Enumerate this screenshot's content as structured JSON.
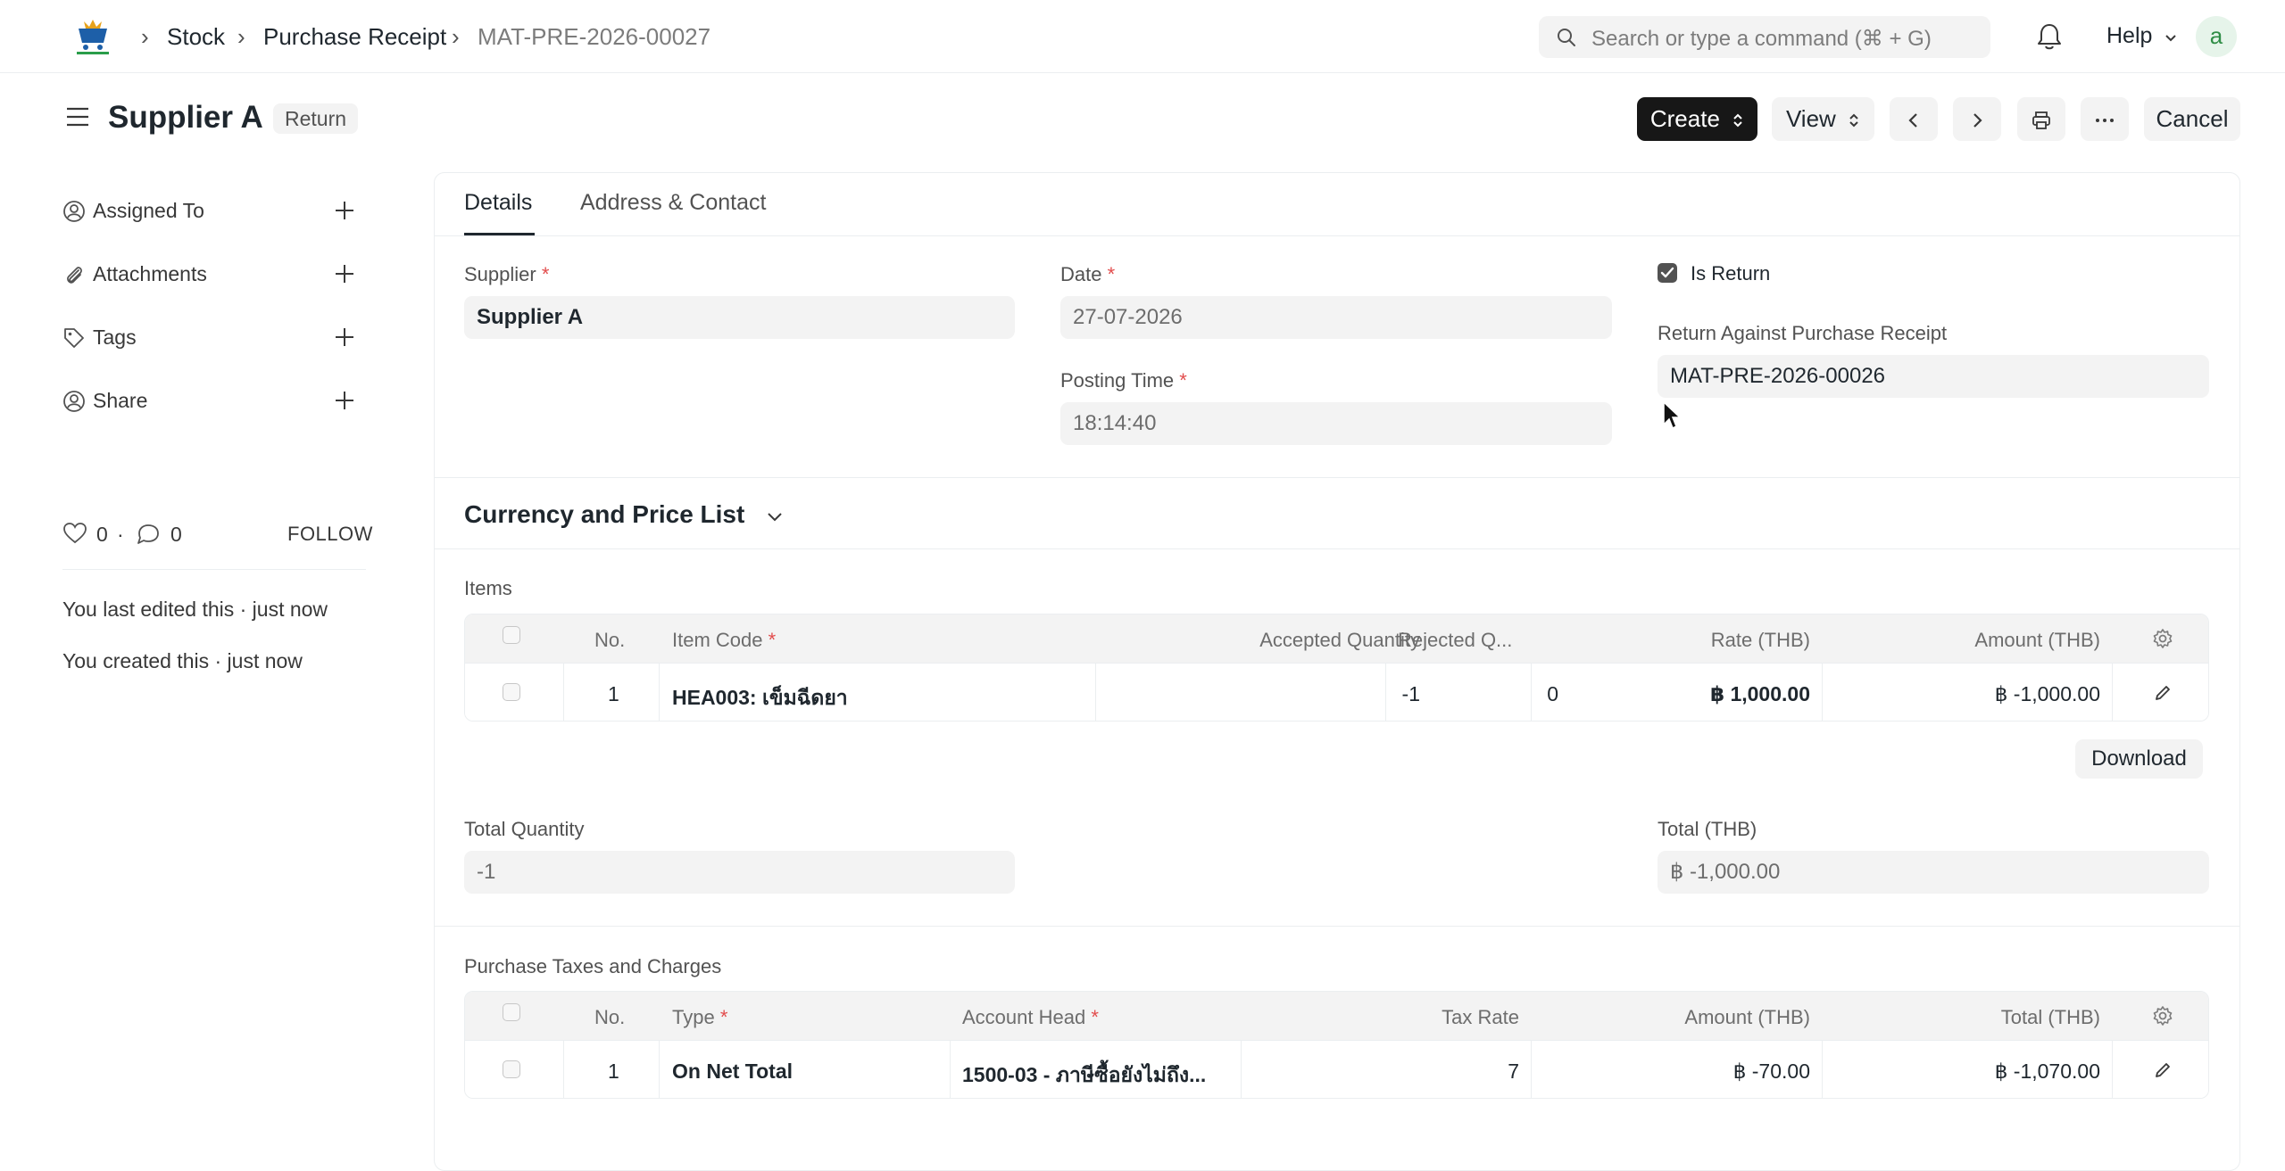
{
  "navbar": {
    "breadcrumbs": [
      "Stock",
      "Purchase Receipt",
      "MAT-PRE-2026-00027"
    ],
    "search_placeholder": "Search or type a command (⌘ + G)",
    "help_label": "Help",
    "avatar_letter": "a"
  },
  "page": {
    "title": "Supplier A",
    "status": "Return",
    "buttons": {
      "create": "Create",
      "view": "View",
      "cancel": "Cancel"
    }
  },
  "sidebar": {
    "items": [
      {
        "label": "Assigned To",
        "icon": "assign-user-icon"
      },
      {
        "label": "Attachments",
        "icon": "paperclip-icon"
      },
      {
        "label": "Tags",
        "icon": "tag-icon"
      },
      {
        "label": "Share",
        "icon": "share-user-icon"
      }
    ],
    "likes": "0",
    "comments": "0",
    "follow_label": "FOLLOW",
    "last_edited": "You last edited this · just now",
    "created": "You created this · just now"
  },
  "tabs": [
    "Details",
    "Address & Contact"
  ],
  "details": {
    "supplier": {
      "label": "Supplier",
      "value": "Supplier A"
    },
    "date": {
      "label": "Date",
      "value": "27-07-2026"
    },
    "posting_time": {
      "label": "Posting Time",
      "value": "18:14:40"
    },
    "is_return": {
      "label": "Is Return",
      "checked": true
    },
    "return_against": {
      "label": "Return Against Purchase Receipt",
      "value": "MAT-PRE-2026-00026"
    }
  },
  "currency_section": {
    "title": "Currency and Price List"
  },
  "items": {
    "label": "Items",
    "columns": [
      "No.",
      "Item Code",
      "Accepted Quantity",
      "Rejected Q...",
      "Rate (THB)",
      "Amount (THB)"
    ],
    "rows": [
      {
        "no": "1",
        "item_code": "HEA003: เข็มฉีดยา",
        "accepted_qty": "-1",
        "rejected_qty": "0",
        "rate": "฿ 1,000.00",
        "amount": "฿ -1,000.00"
      }
    ],
    "download_label": "Download"
  },
  "totals": {
    "total_quantity": {
      "label": "Total Quantity",
      "value": "-1"
    },
    "total": {
      "label": "Total (THB)",
      "value": "฿ -1,000.00"
    }
  },
  "taxes": {
    "label": "Purchase Taxes and Charges",
    "columns": [
      "No.",
      "Type",
      "Account Head",
      "Tax Rate",
      "Amount (THB)",
      "Total (THB)"
    ],
    "rows": [
      {
        "no": "1",
        "type": "On Net Total",
        "account_head": "1500-03 - ภาษีซื้อยังไม่ถึง...",
        "tax_rate": "7",
        "amount": "฿ -70.00",
        "total": "฿ -1,070.00"
      }
    ]
  },
  "colors": {
    "primary_dark": "#171717",
    "required": "#e24c4c",
    "field_bg": "#f3f3f3",
    "border": "#ebeef0"
  }
}
